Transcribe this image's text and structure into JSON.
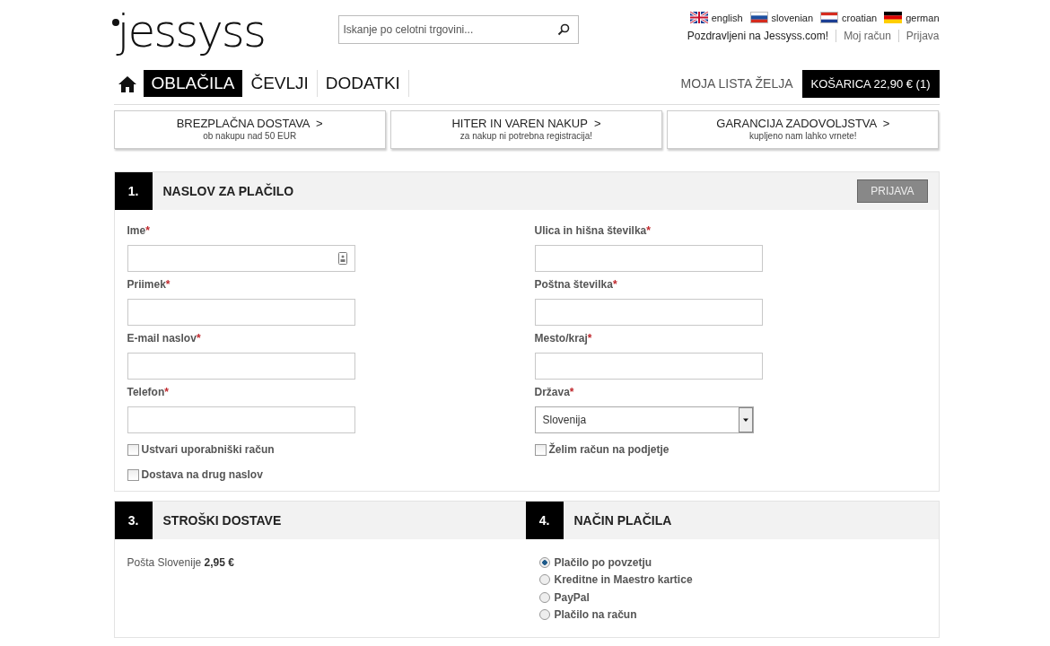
{
  "header": {
    "logo": "jessyss",
    "search": {
      "placeholder": "Iskanje po celotni trgovini..."
    },
    "languages": [
      {
        "label": "english",
        "kind": "uk"
      },
      {
        "label": "slovenian",
        "kind": "si"
      },
      {
        "label": "croatian",
        "kind": "hr"
      },
      {
        "label": "german",
        "kind": "de"
      }
    ],
    "greeting": "Pozdravljeni na Jessyss.com!",
    "links": [
      "Moj račun",
      "Prijava"
    ]
  },
  "nav": {
    "items": [
      {
        "label": "OBLAČILA",
        "selected": true
      },
      {
        "label": "ČEVLJI",
        "selected": false
      },
      {
        "label": "DODATKI",
        "selected": false
      }
    ],
    "wishlist": "MOJA LISTA ŽELJA",
    "cart": {
      "label": "KOŠARICA",
      "amount": "22,90 € (1)"
    }
  },
  "promos": [
    {
      "title": "BREZPLAČNA DOSTAVA  >",
      "subtitle": "ob nakupu nad 50 EUR"
    },
    {
      "title": "HITER IN VAREN NAKUP  >",
      "subtitle": "za nakup ni potrebna registracija!"
    },
    {
      "title": "GARANCIJA ZADOVOLJSTVA  >",
      "subtitle": "kupljeno nam lahko vrnete!"
    }
  ],
  "billing": {
    "number": "1.",
    "title": "NASLOV ZA PLAČILO",
    "login_button": "PRIJAVA",
    "left_fields": [
      {
        "label": "Ime",
        "asterisk": "*",
        "kind": "contact"
      },
      {
        "label": "Priimek",
        "asterisk": "*",
        "kind": "text"
      },
      {
        "label": "E-mail naslov",
        "asterisk": "*",
        "kind": "text"
      },
      {
        "label": "Telefon",
        "asterisk": "*",
        "kind": "text"
      }
    ],
    "right_fields": [
      {
        "label": "Ulica in hišna številka",
        "asterisk": "*",
        "kind": "text"
      },
      {
        "label": "Poštna številka",
        "asterisk": "*",
        "kind": "text"
      },
      {
        "label": "Mesto/kraj",
        "asterisk": "*",
        "kind": "text"
      },
      {
        "label": "Država",
        "asterisk": "*",
        "kind": "select",
        "value": "Slovenija"
      }
    ],
    "left_checkboxes": [
      {
        "label": "Ustvari uporabniški račun",
        "checked": false
      },
      {
        "label": "Dostava na drug naslov",
        "checked": false
      }
    ],
    "right_checkboxes": [
      {
        "label": "Želim račun na podjetje",
        "checked": false
      }
    ]
  },
  "shipping": {
    "number": "3.",
    "title": "STROŠKI DOSTAVE",
    "method": "Pošta Slovenije",
    "price": "2,95 €"
  },
  "payment": {
    "number": "4.",
    "title": "NAČIN PLAČILA",
    "options": [
      {
        "label": "Plačilo po povzetju",
        "selected": true
      },
      {
        "label": "Kreditne in Maestro kartice",
        "selected": false
      },
      {
        "label": "PayPal",
        "selected": false
      },
      {
        "label": "Plačilo na račun",
        "selected": false
      }
    ]
  }
}
